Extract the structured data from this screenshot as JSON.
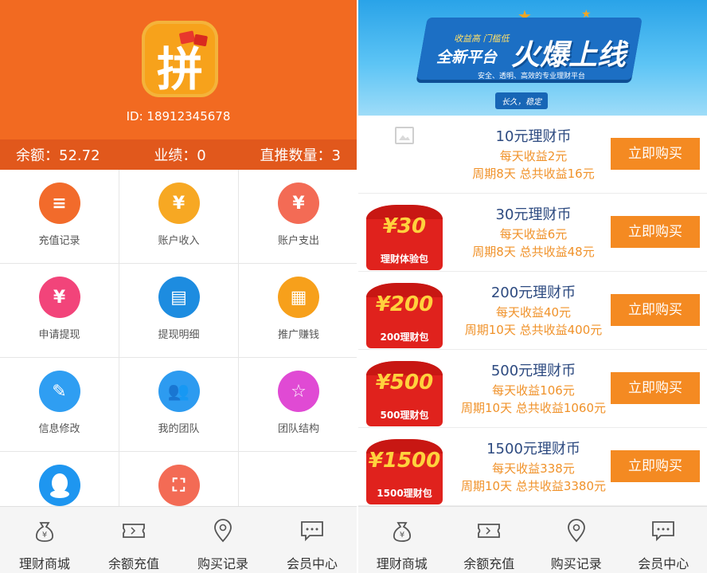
{
  "left": {
    "logo_text": "拼",
    "user_id": "ID:  18912345678",
    "stats": {
      "balance": "余额：52.72",
      "performance": "业绩：0",
      "direct_count": "直推数量：3"
    },
    "menu": [
      {
        "label": "充值记录",
        "icon": "document-icon",
        "color": "#f26b2b",
        "glyph": "≡"
      },
      {
        "label": "账户收入",
        "icon": "coin-hand-icon",
        "color": "#f7a823",
        "glyph": "¥"
      },
      {
        "label": "账户支出",
        "icon": "money-bag-icon",
        "color": "#f36b55",
        "glyph": "¥"
      },
      {
        "label": "申请提现",
        "icon": "money-bag-pink-icon",
        "color": "#f2447a",
        "glyph": "¥"
      },
      {
        "label": "提现明细",
        "icon": "list-icon",
        "color": "#1d8ce0",
        "glyph": "▤"
      },
      {
        "label": "推广赚钱",
        "icon": "qr-code-icon",
        "color": "#f7a01b",
        "glyph": "▦"
      },
      {
        "label": "信息修改",
        "icon": "edit-info-icon",
        "color": "#2f9ef2",
        "glyph": "✎"
      },
      {
        "label": "我的团队",
        "icon": "team-icon",
        "color": "#2d9bf0",
        "glyph": "👥"
      },
      {
        "label": "团队结构",
        "icon": "star-icon",
        "color": "#e04ad4",
        "glyph": "☆"
      },
      {
        "label": "",
        "icon": "qq-icon",
        "color": "#1e96f0",
        "glyph": ""
      },
      {
        "label": "",
        "icon": "expand-icon",
        "color": "#f36b55",
        "glyph": "⛶"
      },
      {
        "label": "",
        "icon": "",
        "color": "",
        "glyph": ""
      }
    ]
  },
  "tabs": [
    "理财商城",
    "余额充值",
    "购买记录",
    "会员中心"
  ],
  "right": {
    "banner": {
      "sub": "收益高 门槛低",
      "title1": "全新平台",
      "title2": "火爆上线",
      "tagline": "安全、透明、高效的专业理财平台",
      "pill": "长久，稳定"
    },
    "products": [
      {
        "thumb": "",
        "caption": "",
        "name": "10元理财币",
        "daily": "每天收益2元",
        "period": "周期8天  总共收益16元",
        "buy": "立即购买"
      },
      {
        "thumb": "¥30",
        "caption": "理财体验包",
        "name": "30元理财币",
        "daily": "每天收益6元",
        "period": "周期8天  总共收益48元",
        "buy": "立即购买"
      },
      {
        "thumb": "¥200",
        "caption": "200理财包",
        "name": "200元理财币",
        "daily": "每天收益40元",
        "period": "周期10天  总共收益400元",
        "buy": "立即购买"
      },
      {
        "thumb": "¥500",
        "caption": "500理财包",
        "name": "500元理财币",
        "daily": "每天收益106元",
        "period": "周期10天  总共收益1060元",
        "buy": "立即购买"
      },
      {
        "thumb": "¥1500",
        "caption": "1500理财包",
        "name": "1500元理财币",
        "daily": "每天收益338元",
        "period": "周期10天  总共收益3380元",
        "buy": "立即购买"
      }
    ]
  }
}
